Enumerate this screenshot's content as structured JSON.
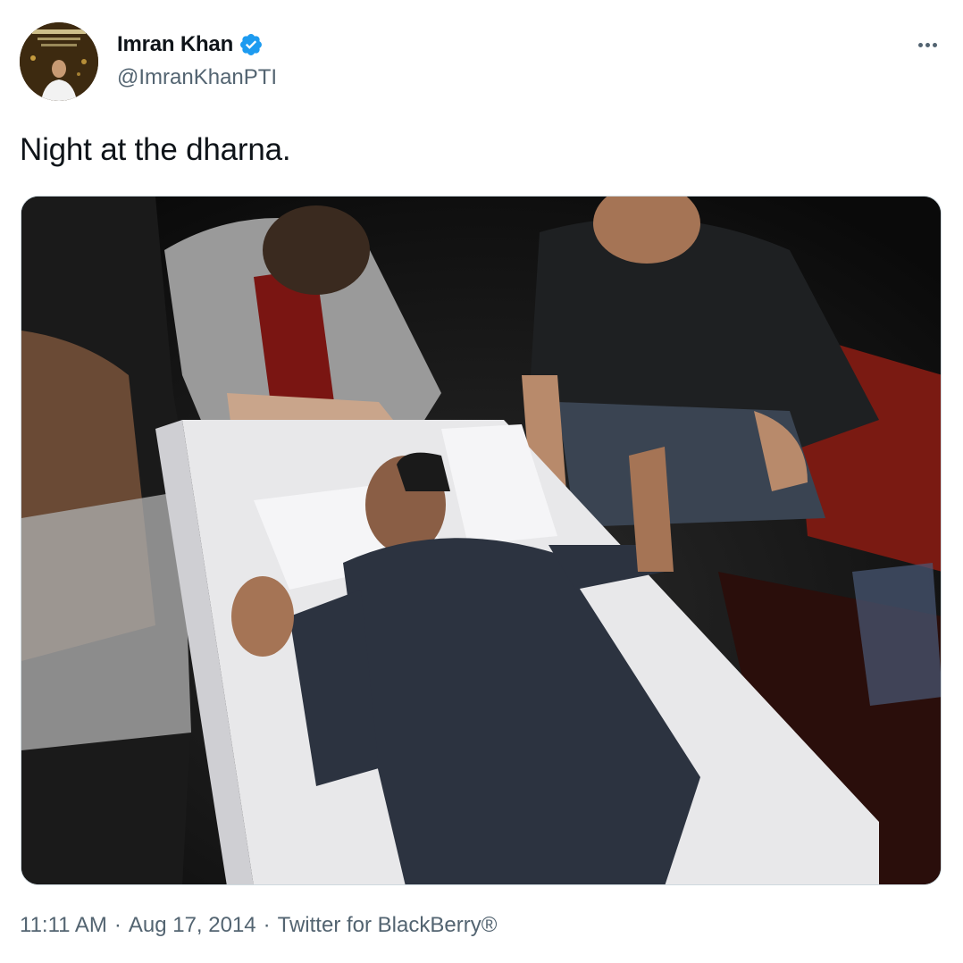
{
  "author": {
    "display_name": "Imran Khan",
    "handle": "@ImranKhanPTI",
    "verified": true,
    "avatar_icon": "profile-photo"
  },
  "tweet": {
    "text": "Night at the dharna."
  },
  "media": {
    "alt": "photo"
  },
  "footer": {
    "time": "11:11 AM",
    "separator": "·",
    "date": "Aug 17, 2014",
    "source": "Twitter for BlackBerry®"
  },
  "actions": {
    "more_icon": "more-horizontal-icon"
  },
  "colors": {
    "text_primary": "#0f1419",
    "text_secondary": "#536471",
    "verified_blue": "#1d9bf0"
  }
}
